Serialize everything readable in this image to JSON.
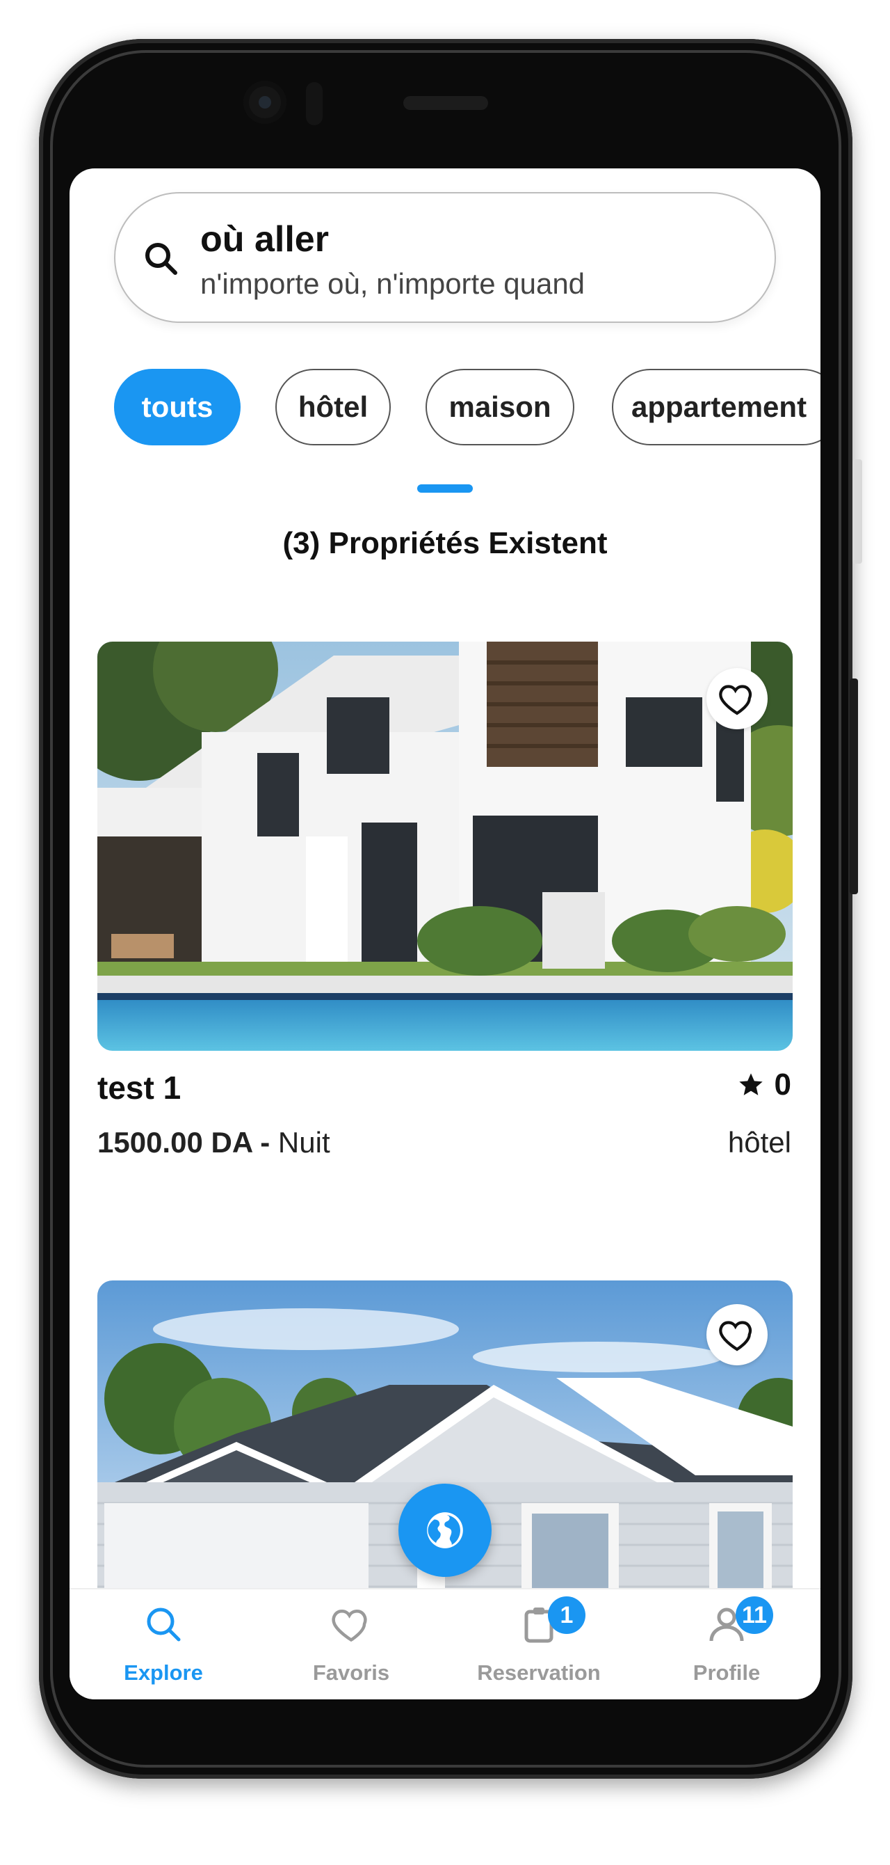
{
  "search": {
    "title": "où aller",
    "subtitle": "n'importe où, n'importe quand"
  },
  "categories": [
    {
      "label": "touts",
      "active": true
    },
    {
      "label": "hôtel",
      "active": false
    },
    {
      "label": "maison",
      "active": false
    },
    {
      "label": "appartement",
      "active": false
    }
  ],
  "results": {
    "count_text": "(3) Propriétés Existent"
  },
  "listings": [
    {
      "title": "test 1",
      "rating": "0",
      "price": "1500.00 DA -",
      "unit": "Nuit",
      "type": "hôtel",
      "favorite": false
    },
    {
      "title": "",
      "rating": "",
      "price": "",
      "unit": "",
      "type": "",
      "favorite": false
    }
  ],
  "bottom_nav": {
    "items": [
      {
        "label": "Explore",
        "icon": "search-icon",
        "active": true,
        "badge": ""
      },
      {
        "label": "Favoris",
        "icon": "heart-icon",
        "active": false,
        "badge": ""
      },
      {
        "label": "Reservation",
        "icon": "clipboard-icon",
        "active": false,
        "badge": "1"
      },
      {
        "label": "Profile",
        "icon": "user-icon",
        "active": false,
        "badge": "11"
      }
    ]
  },
  "colors": {
    "accent": "#1a96f2",
    "inactive": "#9a9a9a"
  }
}
